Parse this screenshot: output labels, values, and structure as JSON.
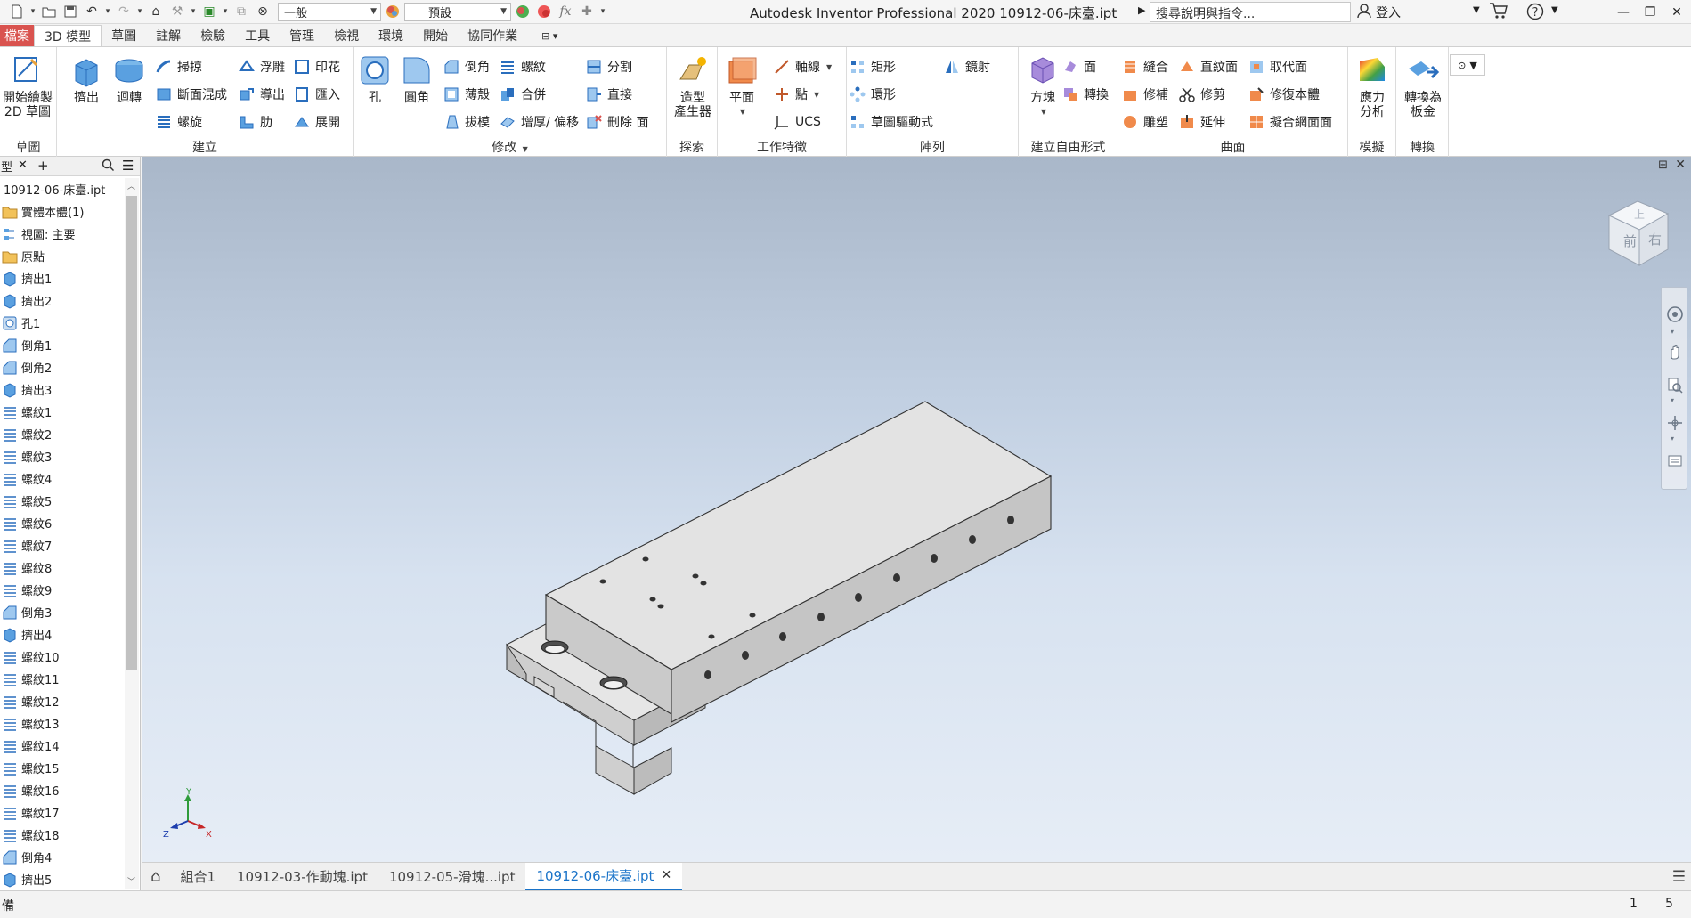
{
  "title_bar": {
    "app_title": "Autodesk Inventor Professional 2020   10912-06-床臺.ipt",
    "material_combo": "一般",
    "appearance_combo": "預設",
    "search_placeholder": "搜尋說明與指令...",
    "signin_label": "登入"
  },
  "tabs": [
    "檔案",
    "3D 模型",
    "草圖",
    "註解",
    "檢驗",
    "工具",
    "管理",
    "檢視",
    "環境",
    "開始",
    "協同作業"
  ],
  "active_tab": "3D 模型",
  "ribbon": {
    "sketch": {
      "title": "草圖",
      "start_sketch": "開始繪製",
      "start_sketch2": "2D 草圖"
    },
    "create": {
      "title": "建立",
      "extrude": "擠出",
      "revolve": "迴轉",
      "sweep": "掃掠",
      "loft": "斷面混成",
      "coil": "螺旋",
      "emboss": "浮雕",
      "derive": "導出",
      "rib": "肋",
      "decal": "印花",
      "import": "匯入",
      "unwrap": "展開"
    },
    "modify": {
      "title": "修改",
      "hole": "孔",
      "fillet": "圓角",
      "chamfer": "倒角",
      "shell": "薄殼",
      "draft": "拔模",
      "thread": "螺紋",
      "combine": "合併",
      "thicken": "增厚/ 偏移",
      "split": "分割",
      "direct": "直接",
      "delete_face": "刪除 面"
    },
    "explore": {
      "title": "探索",
      "shape_gen": "造型",
      "shape_gen2": "產生器"
    },
    "work_features": {
      "title": "工作特徵",
      "plane": "平面",
      "axis": "軸線",
      "point": "點",
      "ucs": "UCS"
    },
    "pattern": {
      "title": "陣列",
      "rect": "矩形",
      "circ": "環形",
      "sketch_driven": "草圖驅動式",
      "mirror": "鏡射"
    },
    "freeform": {
      "title": "建立自由形式",
      "box": "方塊",
      "face": "面",
      "convert": "轉換"
    },
    "surface": {
      "title": "曲面",
      "stitch": "縫合",
      "patch": "修補",
      "sculpt": "雕塑",
      "ruled": "直紋面",
      "trim": "修剪",
      "extend": "延伸",
      "replace": "取代面",
      "repair": "修復本體",
      "fit_mesh": "擬合網面面"
    },
    "simulation": {
      "title": "模擬",
      "stress": "應力",
      "stress2": "分析"
    },
    "convert": {
      "title": "轉換",
      "sheet": "轉換為",
      "sheet2": "板金"
    }
  },
  "browser": {
    "tab_label": "型",
    "file": "10912-06-床臺.ipt",
    "items": [
      {
        "label": "實體本體(1)",
        "icon": "folder-icon"
      },
      {
        "label": "視圖: 主要",
        "icon": "view-icon"
      },
      {
        "label": "原點",
        "icon": "folder-icon"
      },
      {
        "label": "擠出1",
        "icon": "extrude-icon"
      },
      {
        "label": "擠出2",
        "icon": "extrude-icon"
      },
      {
        "label": "孔1",
        "icon": "hole-icon"
      },
      {
        "label": "倒角1",
        "icon": "chamfer-icon"
      },
      {
        "label": "倒角2",
        "icon": "chamfer-icon"
      },
      {
        "label": "擠出3",
        "icon": "extrude-icon"
      },
      {
        "label": "螺紋1",
        "icon": "thread-icon"
      },
      {
        "label": "螺紋2",
        "icon": "thread-icon"
      },
      {
        "label": "螺紋3",
        "icon": "thread-icon"
      },
      {
        "label": "螺紋4",
        "icon": "thread-icon"
      },
      {
        "label": "螺紋5",
        "icon": "thread-icon"
      },
      {
        "label": "螺紋6",
        "icon": "thread-icon"
      },
      {
        "label": "螺紋7",
        "icon": "thread-icon"
      },
      {
        "label": "螺紋8",
        "icon": "thread-icon"
      },
      {
        "label": "螺紋9",
        "icon": "thread-icon"
      },
      {
        "label": "倒角3",
        "icon": "chamfer-icon"
      },
      {
        "label": "擠出4",
        "icon": "extrude-icon"
      },
      {
        "label": "螺紋10",
        "icon": "thread-icon"
      },
      {
        "label": "螺紋11",
        "icon": "thread-icon"
      },
      {
        "label": "螺紋12",
        "icon": "thread-icon"
      },
      {
        "label": "螺紋13",
        "icon": "thread-icon"
      },
      {
        "label": "螺紋14",
        "icon": "thread-icon"
      },
      {
        "label": "螺紋15",
        "icon": "thread-icon"
      },
      {
        "label": "螺紋16",
        "icon": "thread-icon"
      },
      {
        "label": "螺紋17",
        "icon": "thread-icon"
      },
      {
        "label": "螺紋18",
        "icon": "thread-icon"
      },
      {
        "label": "倒角4",
        "icon": "chamfer-icon"
      },
      {
        "label": "擠出5",
        "icon": "extrude-icon"
      }
    ]
  },
  "viewcube": {
    "front": "前",
    "right": "右",
    "top": "上"
  },
  "triad": {
    "x": "X",
    "y": "Y",
    "z": "Z"
  },
  "doc_tabs": [
    "組合1",
    "10912-03-作動塊.ipt",
    "10912-05-滑塊...ipt",
    "10912-06-床臺.ipt"
  ],
  "active_doc": "10912-06-床臺.ipt",
  "status": {
    "left": "備",
    "count1": "1",
    "count2": "5"
  },
  "colors": {
    "accent": "#1a73c8",
    "file_tab": "#d9534f",
    "part_face": "#e3e3e3"
  }
}
